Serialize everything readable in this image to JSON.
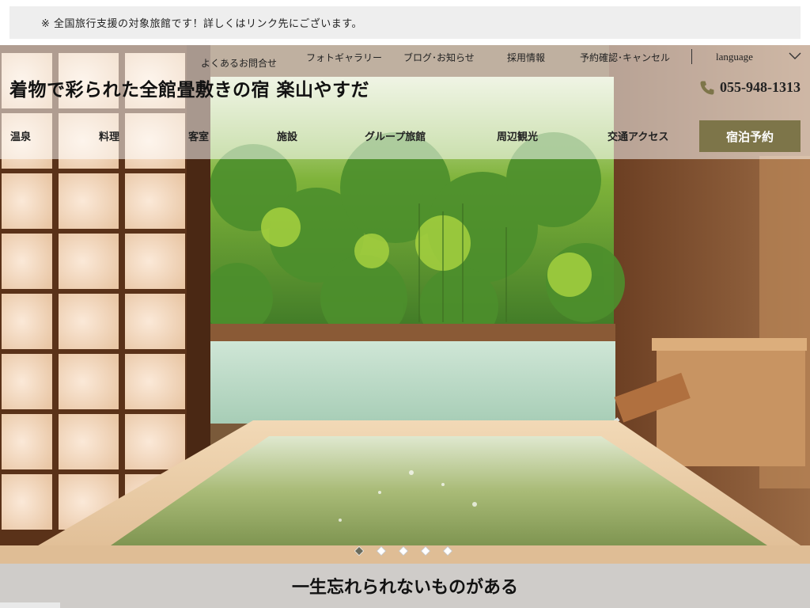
{
  "notice": {
    "text": "※ 全国旅行支援の対象旅館です！詳しくはリンク先にございます。"
  },
  "topnav": {
    "links": [
      {
        "label": "よくあるお問合せ"
      },
      {
        "label": "フォトギャラリー"
      },
      {
        "label": "ブログ･お知らせ"
      },
      {
        "label": "採用情報"
      },
      {
        "label": "予約確認･キャンセル"
      }
    ],
    "language": {
      "label": "language",
      "icon": "chevron-down-icon"
    }
  },
  "header": {
    "title": "着物で彩られた全館畳敷きの宿 楽山やすだ",
    "phone": {
      "icon": "phone-icon",
      "number": "055-948-1313"
    }
  },
  "mainnav": {
    "items": [
      {
        "label": "温泉"
      },
      {
        "label": "料理"
      },
      {
        "label": "客室"
      },
      {
        "label": "施設"
      },
      {
        "label": "グループ旅館"
      },
      {
        "label": "周辺観光"
      },
      {
        "label": "交通アクセス"
      }
    ],
    "reserve_label": "宿泊予約"
  },
  "hero": {
    "image": "private-open-air-wooden-bath-bamboo-forest",
    "slides_total": 5,
    "active_slide": 1
  },
  "tagline": "一生忘れられないものがある",
  "colors": {
    "accent": "#7d7549",
    "notice_bg": "#eeeeee"
  }
}
